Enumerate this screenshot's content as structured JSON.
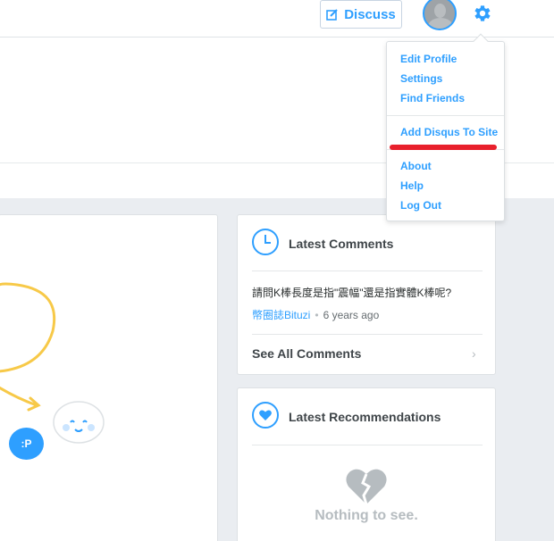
{
  "navbar": {
    "discuss_label": "Discuss"
  },
  "dropdown": {
    "items": [
      "Edit Profile",
      "Settings",
      "Find Friends",
      "Add Disqus To Site",
      "About",
      "Help",
      "Log Out"
    ]
  },
  "latest_comments": {
    "title": "Latest Comments",
    "comment_text": "請問K棒長度是指\"震幅\"還是指實體K棒呢?",
    "author": "幣圈誌Bituzi",
    "time": "6 years ago",
    "see_all": "See All Comments"
  },
  "latest_recommendations": {
    "title": "Latest Recommendations",
    "empty_text": "Nothing to see."
  },
  "chat_bubble_text": ":P",
  "colors": {
    "accent": "#2e9fff",
    "highlight": "#e8202c",
    "arrow": "#f7c948"
  }
}
